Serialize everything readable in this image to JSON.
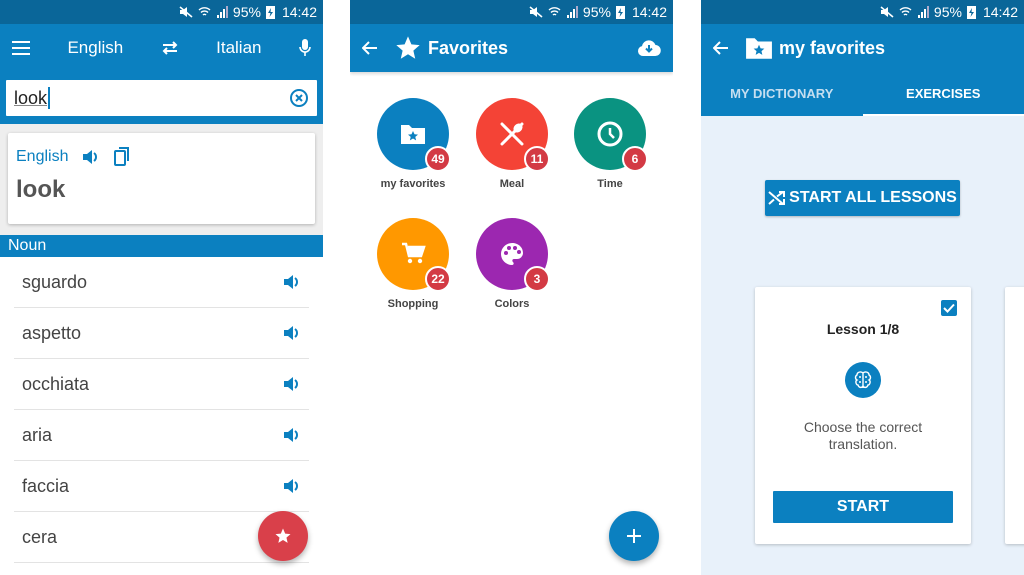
{
  "status_bar": {
    "battery": "95%",
    "time": "14:42"
  },
  "translator": {
    "source_lang": "English",
    "target_lang": "Italian",
    "search": {
      "value": "look",
      "placeholder": ""
    },
    "result": {
      "language": "English",
      "word": "look"
    },
    "part_of_speech": "Noun",
    "translations": [
      {
        "word": "sguardo"
      },
      {
        "word": "aspetto"
      },
      {
        "word": "occhiata"
      },
      {
        "word": "aria"
      },
      {
        "word": "faccia"
      },
      {
        "word": "cera"
      }
    ]
  },
  "favorites": {
    "title": "Favorites",
    "folders": [
      {
        "label": "my favorites",
        "count": "49",
        "color": "#0b80c0",
        "icon": "folder-star-icon"
      },
      {
        "label": "Meal",
        "count": "11",
        "color": "#f44336",
        "icon": "utensils-icon"
      },
      {
        "label": "Time",
        "count": "6",
        "color": "#0a9381",
        "icon": "clock-icon"
      },
      {
        "label": "Shopping",
        "count": "22",
        "color": "#ff9800",
        "icon": "cart-icon"
      },
      {
        "label": "Colors",
        "count": "3",
        "color": "#9c27b0",
        "icon": "palette-icon"
      }
    ]
  },
  "my_favorites": {
    "title": "my favorites",
    "tabs": [
      {
        "label": "MY DICTIONARY",
        "active": false
      },
      {
        "label": "EXERCISES",
        "active": true
      }
    ],
    "start_all_label": "START ALL LESSONS",
    "lesson": {
      "title": "Lesson 1/8",
      "checked": true,
      "description": "Choose the correct translation.",
      "start_label": "START"
    }
  },
  "colors": {
    "primary": "#0b80c0",
    "status_bar": "#0a6699",
    "accent_red": "#d9404a"
  }
}
